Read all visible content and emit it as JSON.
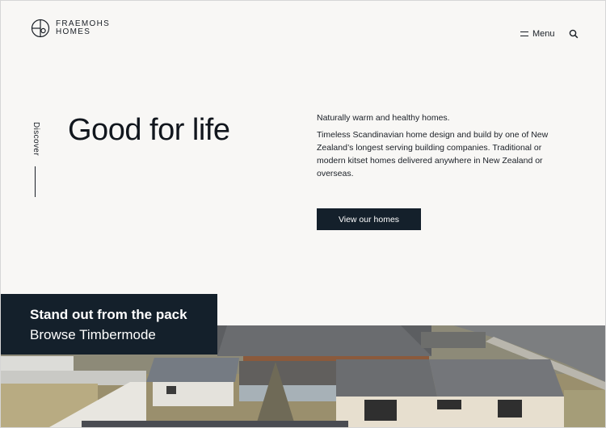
{
  "brand": {
    "line1": "FRAEMOHS",
    "line2": "HOMES"
  },
  "nav": {
    "menu_label": "Menu"
  },
  "hero": {
    "side_label": "Discover",
    "title": "Good for life",
    "intro_1": "Naturally warm and healthy homes.",
    "intro_2": "Timeless Scandinavian home design and build by one of New Zealand’s longest serving building companies. Traditional or modern kitset homes delivered anywhere in New Zealand or overseas.",
    "cta_label": "View our homes"
  },
  "promo": {
    "line1": "Stand out from the pack",
    "line2": "Browse Timbermode"
  },
  "colors": {
    "background": "#f8f7f5",
    "dark": "#14202b",
    "text": "#1a1f26"
  },
  "icons": [
    "logo-mark-icon",
    "menu-icon",
    "search-icon"
  ]
}
